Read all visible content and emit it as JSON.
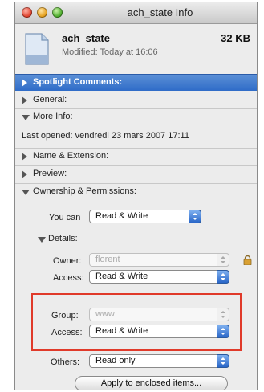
{
  "window": {
    "title": "ach_state Info"
  },
  "file": {
    "name": "ach_state",
    "size": "32 KB",
    "modified": "Modified: Today at 16:06"
  },
  "sections": {
    "spotlight": "Spotlight Comments:",
    "general": "General:",
    "more_info": "More Info:",
    "last_opened": "Last opened: vendredi 23 mars 2007 17:11",
    "name_ext": "Name & Extension:",
    "preview": "Preview:",
    "ownership": "Ownership & Permissions:"
  },
  "permissions": {
    "you_can_label": "You can",
    "you_can_value": "Read & Write",
    "details_label": "Details:",
    "owner_label": "Owner:",
    "owner_value": "florent",
    "owner_access_label": "Access:",
    "owner_access_value": "Read & Write",
    "group_label": "Group:",
    "group_value": "www",
    "group_access_label": "Access:",
    "group_access_value": "Read & Write",
    "others_label": "Others:",
    "others_value": "Read only",
    "apply_label": "Apply to enclosed items..."
  },
  "colors": {
    "selected_section": "#3a76cf",
    "highlight_box": "#e03a2a"
  },
  "icons": {
    "lock": "lock-icon",
    "file": "document-icon"
  }
}
